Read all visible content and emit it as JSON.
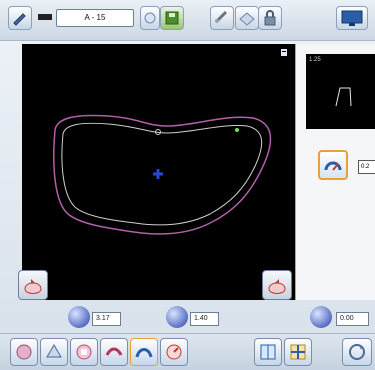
{
  "header": {
    "job_value": "A - 15"
  },
  "side_panel": {
    "mini_label": "1.25",
    "field_value": "0.2"
  },
  "bottom_values": {
    "value_1": "3.17",
    "value_2": "1.40",
    "value_3": "0.00"
  },
  "colors": {
    "outer_trace": "#b15fa9",
    "inner_trace": "#cfcfcf",
    "center_marker": "#2b46d6",
    "accent": "#e6a23a",
    "trace_bg": "#000000"
  },
  "icons": [
    "view-icon",
    "save-icon",
    "tools-icon",
    "lock-icon",
    "monitor-icon",
    "pin-icon",
    "lens-icon",
    "gauge-icon",
    "drop-icon",
    "rotate-icon"
  ]
}
